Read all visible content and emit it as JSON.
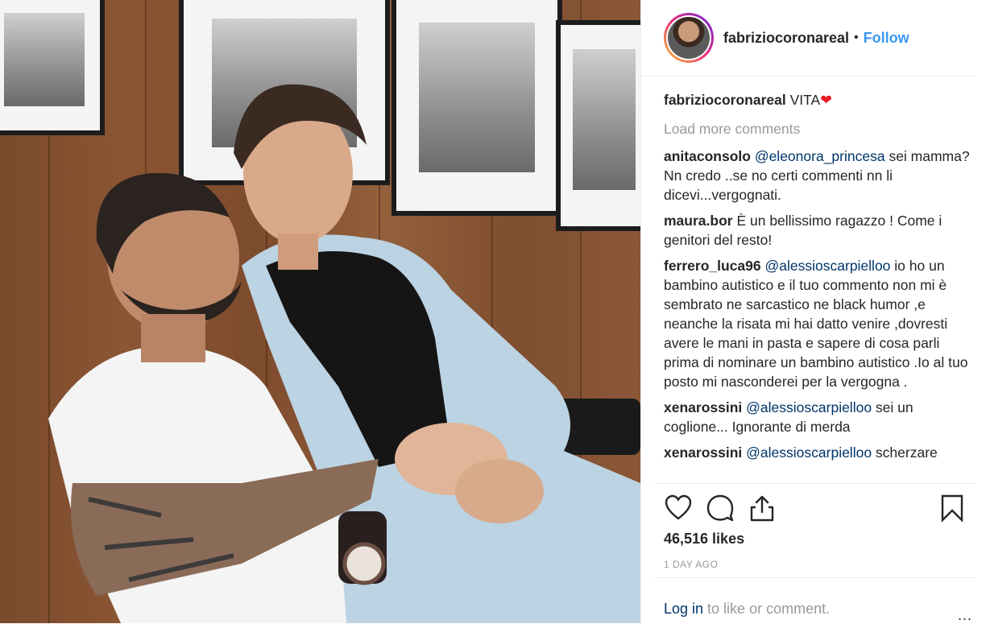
{
  "post": {
    "username": "fabriziocoronareal",
    "dot": "•",
    "follow_label": "Follow",
    "photo_alt": ""
  },
  "caption": {
    "username": "fabriziocoronareal",
    "text": "VITA",
    "emoji": "❤"
  },
  "load_more": "Load more comments",
  "comments": [
    {
      "user": "anitaconsolo",
      "mention": "@eleonora_princesa",
      "text": " sei mamma? Nn credo ..se no certi commenti nn li dicevi...vergognati."
    },
    {
      "user": "maura.bor",
      "mention": "",
      "text": "È un bellissimo ragazzo ! Come i genitori del resto!"
    },
    {
      "user": "ferrero_luca96",
      "mention": "@alessioscarpielloo",
      "text": " io ho un bambino autistico e il tuo commento non mi è sembrato ne sarcastico ne black humor ,e neanche la risata mi hai datto venire ,dovresti avere le mani in pasta e sapere di cosa parli prima di nominare un bambino autistico .Io al tuo posto mi nasconderei per la vergogna ."
    },
    {
      "user": "xenarossini",
      "mention": "@alessioscarpielloo",
      "text": " sei un coglione... Ignorante di merda"
    },
    {
      "user": "xenarossini",
      "mention": "@alessioscarpielloo",
      "text": " scherzare"
    }
  ],
  "actions": {
    "like_icon": "heart-icon",
    "comment_icon": "comment-icon",
    "share_icon": "share-icon",
    "save_icon": "bookmark-icon"
  },
  "likes": "46,516 likes",
  "timestamp": "1 DAY AGO",
  "login": {
    "link": "Log in",
    "text": " to like or comment.",
    "more": "..."
  },
  "colors": {
    "link": "#3897f0",
    "mention": "#003569",
    "muted": "#999999",
    "heart": "#ed1c24"
  }
}
